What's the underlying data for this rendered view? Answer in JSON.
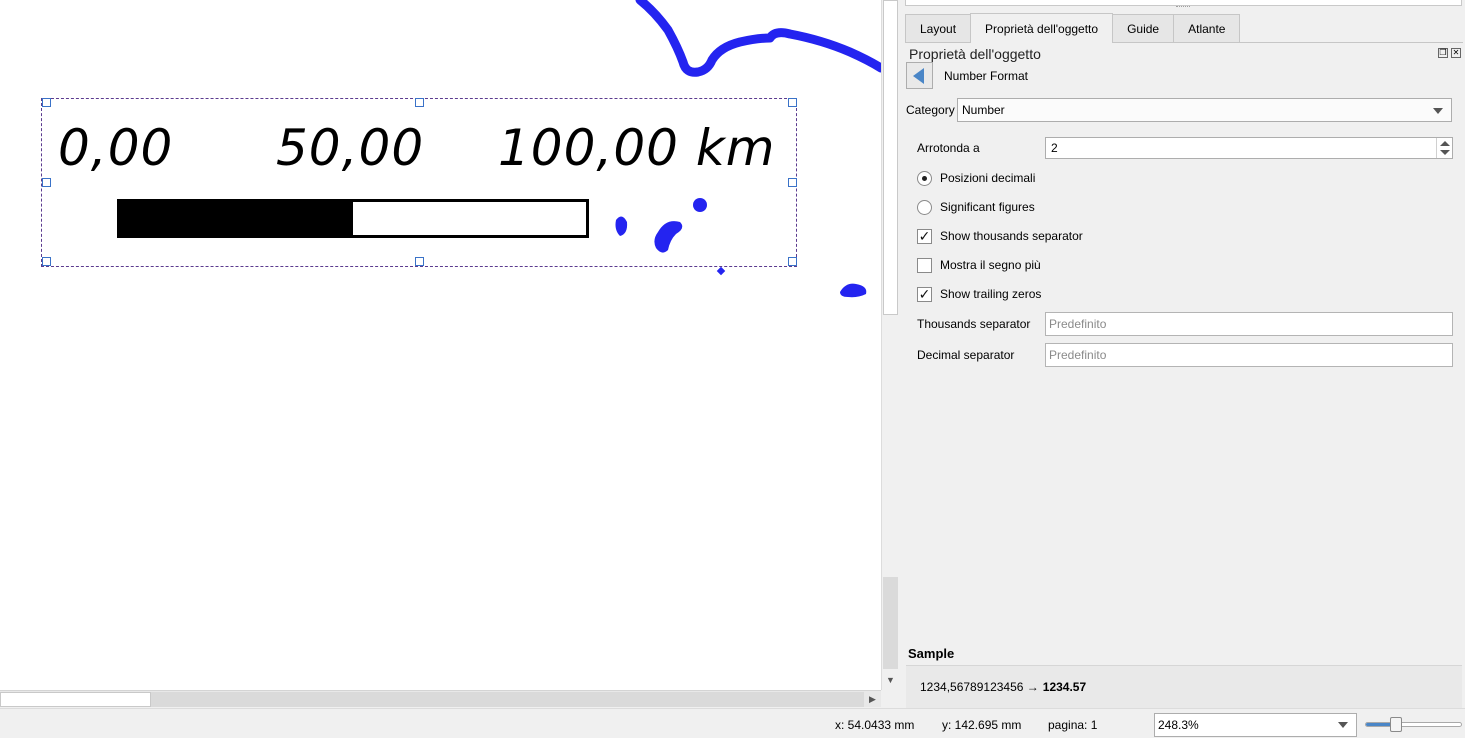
{
  "scale_bar": {
    "labels": [
      "0,00",
      "50,00",
      "100,00 km"
    ],
    "filled_fraction": 0.5
  },
  "colors": {
    "map_feature": "#2424f0",
    "selection_handle": "#3a72c8",
    "accent": "#4a86c7"
  },
  "panel": {
    "tabs": [
      "Layout",
      "Proprietà dell'oggetto",
      "Guide",
      "Atlante"
    ],
    "active_tab": "Proprietà dell'oggetto",
    "title": "Proprietà dell'oggetto",
    "subtitle": "Number Format"
  },
  "number_format": {
    "category_label": "Category",
    "category_value": "Number",
    "round_label": "Arrotonda a",
    "round_value": "2",
    "radio_decimal_label": "Posizioni decimali",
    "radio_significant_label": "Significant figures",
    "radio_selected": "decimal",
    "checkbox_thousands_label": "Show thousands separator",
    "checkbox_thousands_checked": true,
    "checkbox_plus_label": "Mostra il segno più",
    "checkbox_plus_checked": false,
    "checkbox_trailing_label": "Show trailing zeros",
    "checkbox_trailing_checked": true,
    "thousands_sep_label": "Thousands separator",
    "thousands_sep_placeholder": "Predefinito",
    "decimal_sep_label": "Decimal separator",
    "decimal_sep_placeholder": "Predefinito"
  },
  "sample": {
    "label": "Sample",
    "input": "1234,56789123456 →",
    "result": "1234.57"
  },
  "statusbar": {
    "x": "x: 54.0433 mm",
    "y": "y: 142.695 mm",
    "page": "pagina: 1",
    "zoom": "248.3%",
    "zoom_slider_fraction": 0.32
  }
}
